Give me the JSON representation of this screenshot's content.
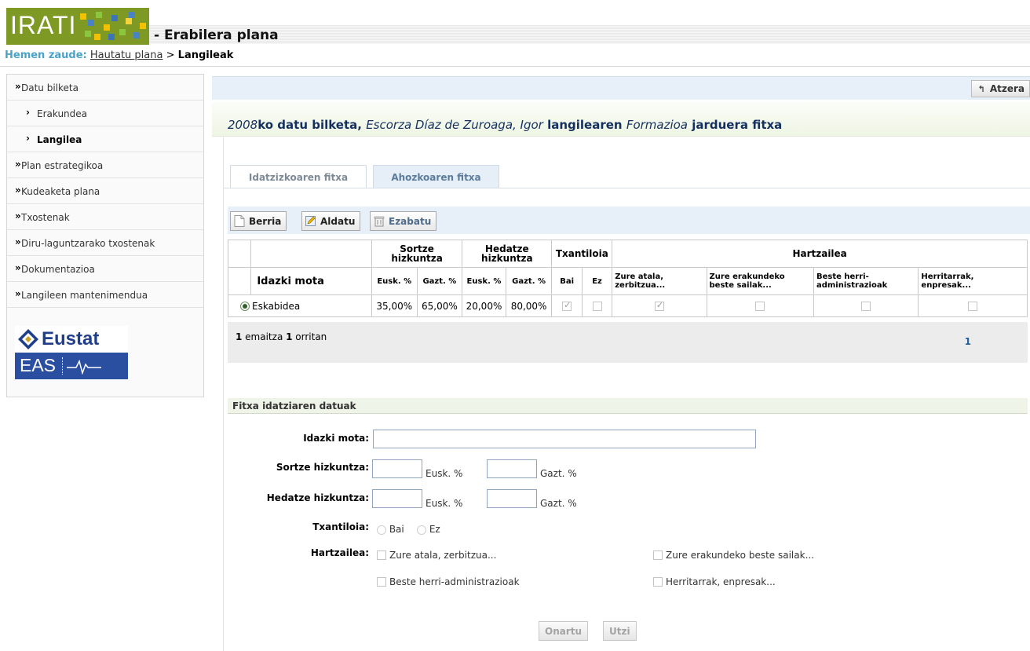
{
  "header": {
    "logo_text": "IRATI",
    "title": "- Erabilera plana"
  },
  "breadcrumb": {
    "label": "Hemen zaude:",
    "link": "Hautatu plana",
    "separator": ">",
    "current": "Langileak"
  },
  "sidebar": {
    "items": [
      {
        "label": "Datu bilketa"
      },
      {
        "label": "Erakundea"
      },
      {
        "label": "Langilea"
      },
      {
        "label": "Plan estrategikoa"
      },
      {
        "label": "Kudeaketa plana"
      },
      {
        "label": "Txostenak"
      },
      {
        "label": "Diru-laguntzarako txostenak"
      },
      {
        "label": "Dokumentazioa"
      },
      {
        "label": "Langileen mantenimendua"
      }
    ],
    "eustat_word": "Eustat",
    "eas_word": "EAS"
  },
  "toolbar_top": {
    "back_label": "Atzera"
  },
  "page_title": {
    "year": "2008",
    "text1": "ko datu bilketa, ",
    "person": "Escorza Díaz de Zuroaga, Igor",
    "text2": " langilearen ",
    "activity": "Formazioa",
    "text3": " jarduera fitxa"
  },
  "tabs": [
    {
      "label": "Idatzizkoaren fitxa"
    },
    {
      "label": "Ahozkoaren fitxa"
    }
  ],
  "actions": {
    "new": "Berria",
    "edit": "Aldatu",
    "delete": "Ezabatu"
  },
  "table": {
    "group_headers": {
      "sortze": "Sortze hizkuntza",
      "hedatze": "Hedatze hizkuntza",
      "txantiloia": "Txantiloia",
      "hartzailea": "Hartzailea"
    },
    "columns": {
      "idazki_mota": "Idazki mota",
      "sortze_eusk": "Eusk. %",
      "sortze_gazt": "Gazt. %",
      "hedatze_eusk": "Eusk. %",
      "hedatze_gazt": "Gazt. %",
      "bai": "Bai",
      "ez": "Ez",
      "zure_atala": "Zure atala, zerbitzua...",
      "zure_erakundeko": "Zure erakundeko beste sailak...",
      "beste_herri": "Beste herri-administrazioak",
      "herritarrak": "Herritarrak, enpresak..."
    },
    "rows": [
      {
        "idazki_mota": "Eskabidea",
        "sortze_eusk": "35,00%",
        "sortze_gazt": "65,00%",
        "hedatze_eusk": "20,00%",
        "hedatze_gazt": "80,00%",
        "bai": true,
        "ez": false,
        "zure_atala": true,
        "zure_erakundeko": false,
        "beste_herri": false,
        "herritarrak": false
      }
    ]
  },
  "pagination": {
    "count": "1",
    "text_mid": " emaitza ",
    "pages": "1",
    "text_end": " orritan",
    "page_link": "1"
  },
  "form": {
    "section_title": "Fitxa idatziaren datuak",
    "idazki_mota_label": "Idazki mota:",
    "idazki_mota_value": "",
    "sortze_label": "Sortze hizkuntza:",
    "hedatze_label": "Hedatze hizkuntza:",
    "eusk_unit": "Eusk. %",
    "gazt_unit": "Gazt. %",
    "txantiloia_label": "Txantiloia:",
    "bai": "Bai",
    "ez": "Ez",
    "hartzailea_label": "Hartzailea:",
    "opt_zure_atala": "Zure atala, zerbitzua...",
    "opt_zure_erakundeko": "Zure erakundeko beste sailak...",
    "opt_beste_herri": "Beste herri-administrazioak",
    "opt_herritarrak": "Herritarrak, enpresak...",
    "accept": "Onartu",
    "cancel": "Utzi"
  },
  "colors": {
    "logo_green": "#7f9a24",
    "title_blue": "#15305e",
    "link_blue": "#26609a",
    "breadcrumb_label": "#4aa3c6",
    "eas_blue": "#2a4ea0"
  }
}
